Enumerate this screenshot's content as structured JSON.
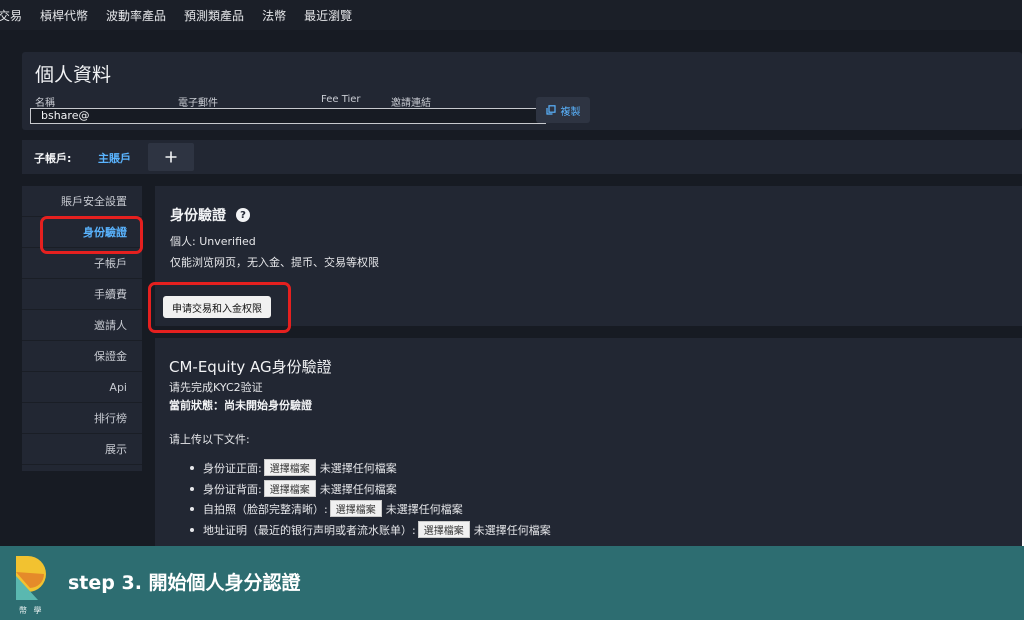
{
  "nav": {
    "items": [
      "交易",
      "槓桿代幣",
      "波動率產品",
      "預測類產品",
      "法幣",
      "最近瀏覽"
    ]
  },
  "profile": {
    "title": "個人資料",
    "labels": {
      "name": "名稱",
      "email": "電子郵件",
      "fee_tier": "Fee Tier",
      "invite_link": "邀請連結"
    },
    "name_value": "bshare@",
    "copy_label": "複製"
  },
  "subaccount": {
    "label": "子帳戶:",
    "main": "主賬戶",
    "add_label": "+"
  },
  "sidebar": {
    "items": [
      {
        "label": "賬戶安全設置"
      },
      {
        "label": "身份驗證"
      },
      {
        "label": "子帳戶"
      },
      {
        "label": "手續費"
      },
      {
        "label": "邀請人"
      },
      {
        "label": "保證金"
      },
      {
        "label": "Api"
      },
      {
        "label": "排行榜"
      },
      {
        "label": "展示"
      }
    ]
  },
  "identity": {
    "title": "身份驗證",
    "personal": "個人: Unverified",
    "limits": "仅能浏览网页，无入金、提币、交易等权限",
    "apply_label": "申请交易和入金权限"
  },
  "cm": {
    "title": "CM-Equity AG身份驗證",
    "instruction": "请先完成KYC2验证",
    "status": "當前狀態：尚未開始身份驗證",
    "upload_title": "请上传以下文件:",
    "file_button": "選擇檔案",
    "no_file": "未選擇任何檔案",
    "docs": [
      {
        "label": "身份证正面:"
      },
      {
        "label": "身份证背面:"
      },
      {
        "label": "自拍照（脸部完整清晰）:"
      },
      {
        "label": "地址证明（最近的银行声明或者流水账单）:"
      }
    ]
  },
  "banner": {
    "step": "step 3.  開始個人身分認證",
    "brand": "幣 學"
  },
  "colors": {
    "accent": "#5ab4ff",
    "highlight": "#e5201f",
    "banner": "#2d6d71"
  }
}
